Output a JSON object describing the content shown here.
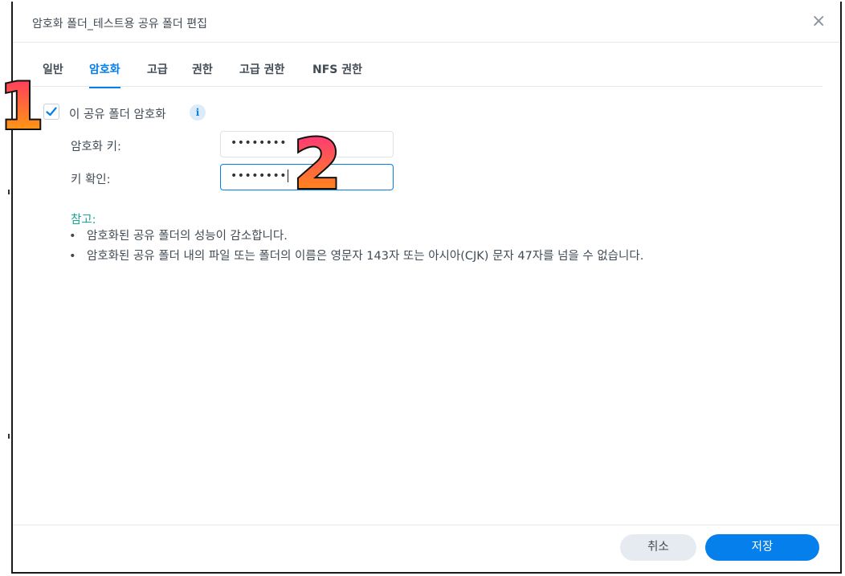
{
  "dialog": {
    "title": "암호화 폴더_테스트용 공유 폴더 편집",
    "close_symbol": "×"
  },
  "tabs": [
    {
      "label": "일반",
      "active": false
    },
    {
      "label": "암호화",
      "active": true
    },
    {
      "label": "고급",
      "active": false
    },
    {
      "label": "권한",
      "active": false
    },
    {
      "label": "고급 권한",
      "active": false
    },
    {
      "label": "NFS 권한",
      "active": false
    }
  ],
  "encrypt": {
    "checkbox_label": "이 공유 폴더 암호화",
    "checked": true,
    "info_symbol": "i"
  },
  "fields": {
    "key_label": "암호화 키:",
    "key_value": "••••••••",
    "confirm_label": "키 확인:",
    "confirm_value": "••••••••"
  },
  "note": {
    "title": "참고:",
    "items": [
      "암호화된 공유 폴더의 성능이 감소합니다.",
      "암호화된 공유 폴더 내의 파일 또는 폴더의 이름은 영문자 143자 또는 아시아(CJK) 문자 47자를 넘을 수 없습니다."
    ]
  },
  "buttons": {
    "cancel": "취소",
    "save": "저장"
  },
  "annotations": {
    "step1": "1",
    "step2": "2"
  },
  "colors": {
    "accent": "#057feb",
    "note_title": "#17a89a",
    "annotation_1_top": "#ff2a6d",
    "annotation_1_bottom": "#ffb000",
    "annotation_2_top": "#ff2a8a",
    "annotation_2_bottom": "#ff9a00"
  },
  "icons": {
    "close": "close-icon",
    "check": "check-icon",
    "info": "info-icon"
  }
}
